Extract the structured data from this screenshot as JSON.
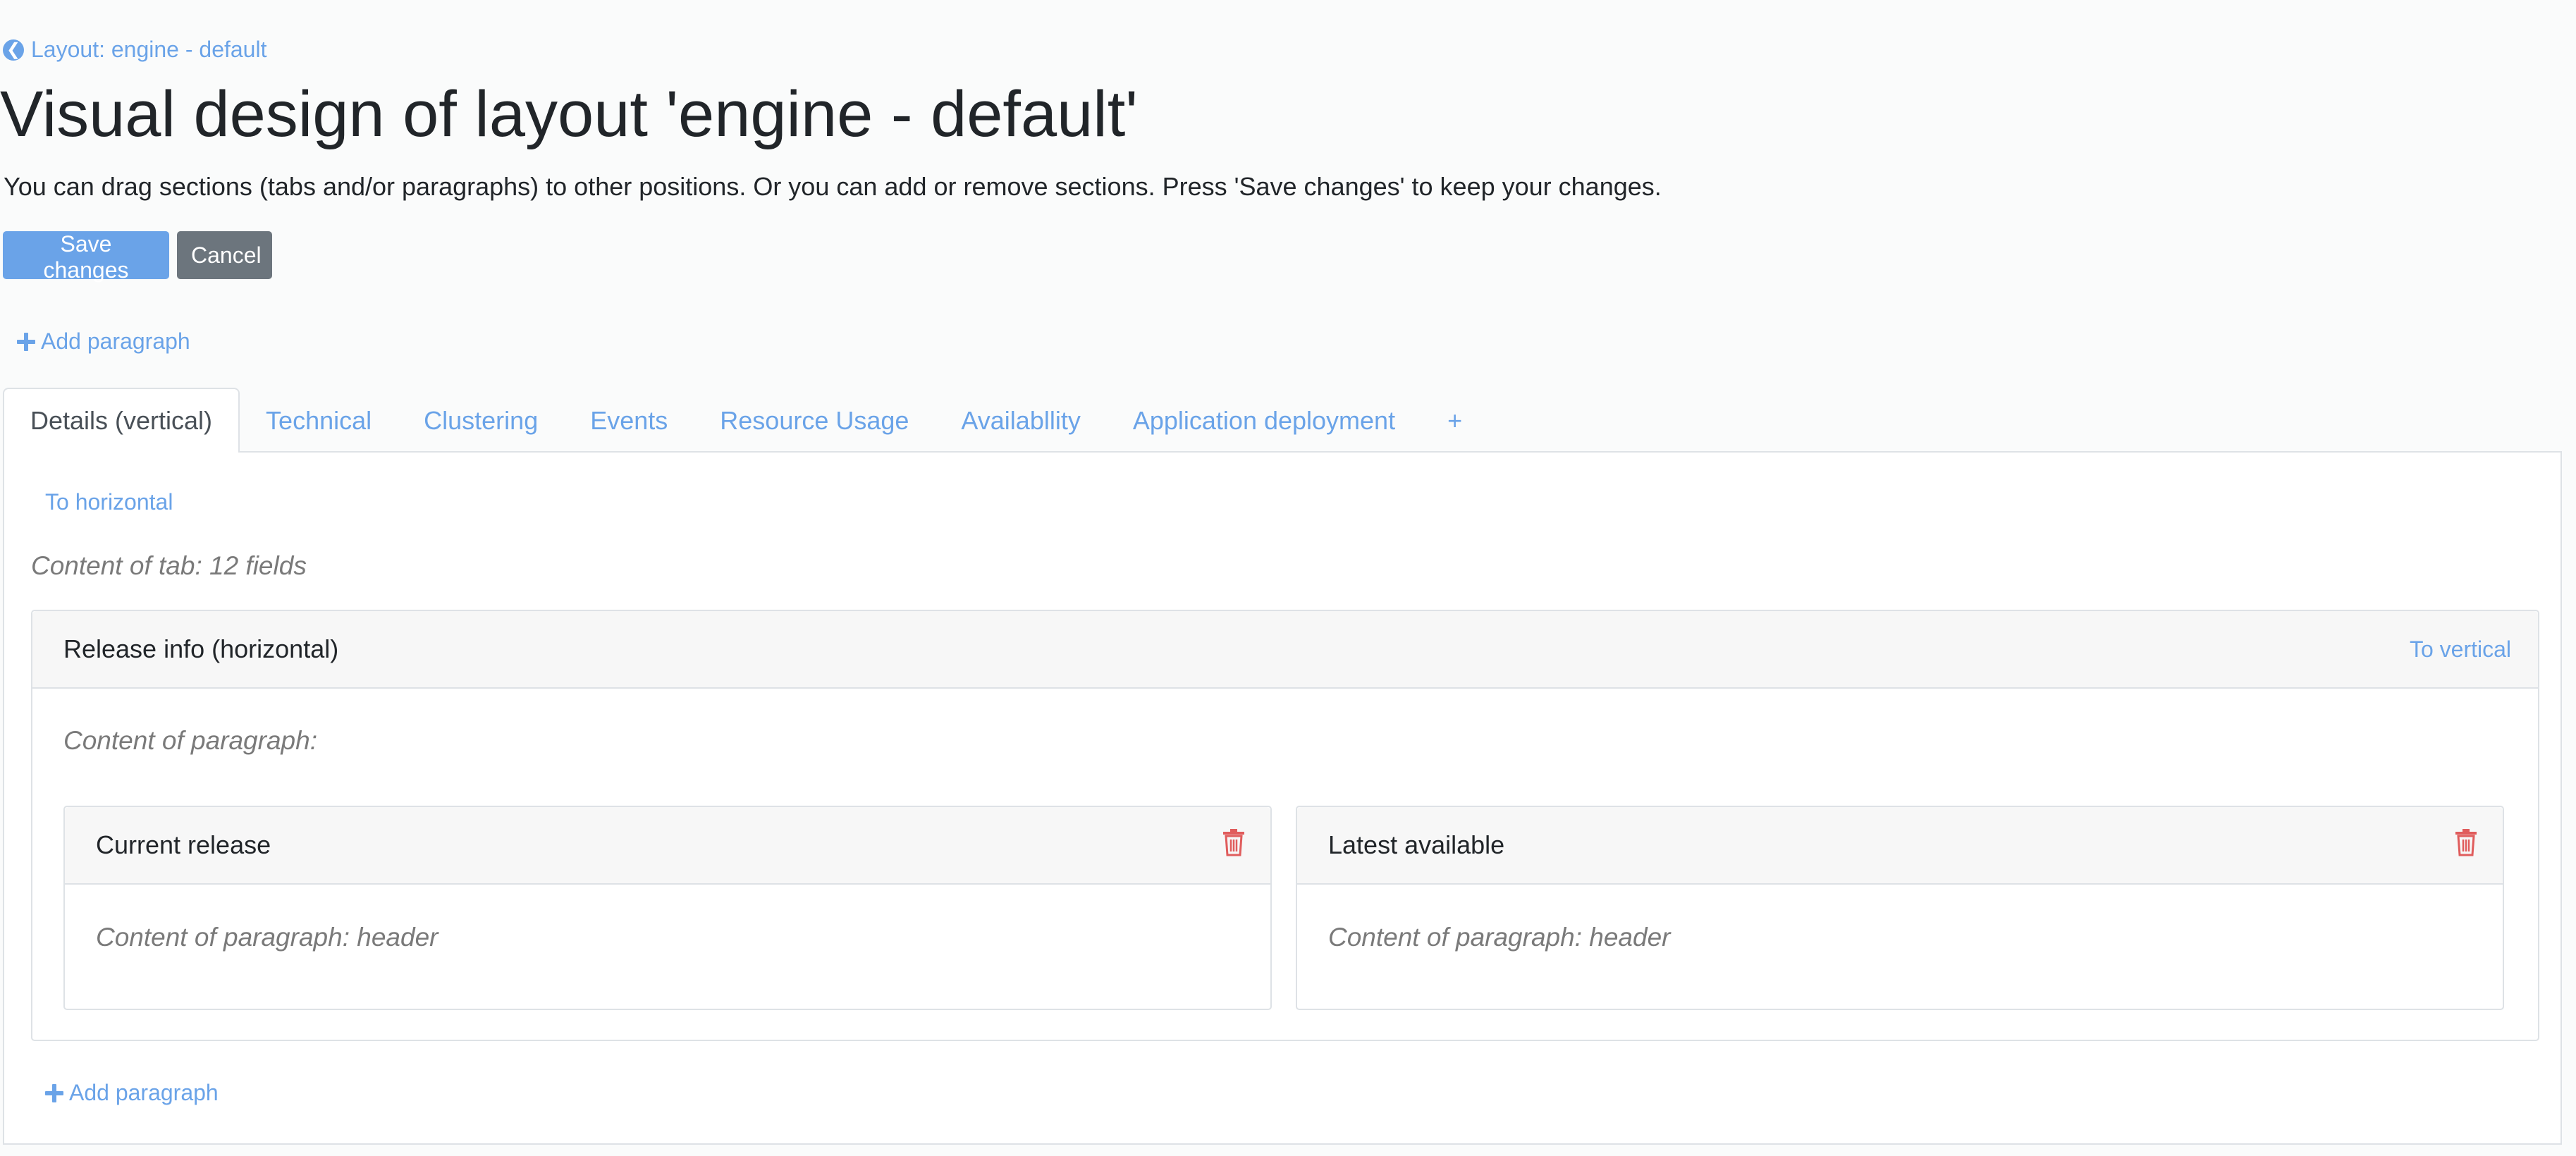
{
  "back_link": {
    "label": "Layout: engine - default",
    "icon": "arrow-circle-left-icon"
  },
  "title": "Visual design of layout 'engine - default'",
  "intro": "You can drag sections (tabs and/or paragraphs) to other positions. Or you can add or remove sections. Press 'Save changes' to keep your changes.",
  "buttons": {
    "save": "Save changes",
    "cancel": "Cancel"
  },
  "add_paragraph_label": "Add paragraph",
  "tabs": [
    {
      "label": "Details (vertical)",
      "active": true
    },
    {
      "label": "Technical"
    },
    {
      "label": "Clustering"
    },
    {
      "label": "Events"
    },
    {
      "label": "Resource Usage"
    },
    {
      "label": "Availabllity"
    },
    {
      "label": "Application deployment"
    },
    {
      "label": "+"
    }
  ],
  "panel": {
    "to_horizontal": "To horizontal",
    "content_of_tab": "Content of tab: 12 fields",
    "paragraph": {
      "title": "Release info (horizontal)",
      "to_vertical": "To vertical",
      "content_label": "Content of paragraph:",
      "subparagraphs": [
        {
          "title": "Current release",
          "content": "Content of paragraph: header"
        },
        {
          "title": "Latest available",
          "content": "Content of paragraph: header"
        }
      ]
    },
    "add_paragraph_label": "Add paragraph"
  },
  "colors": {
    "accent": "#6aa3e8",
    "secondary": "#6c757d",
    "danger": "#e05c5c"
  }
}
